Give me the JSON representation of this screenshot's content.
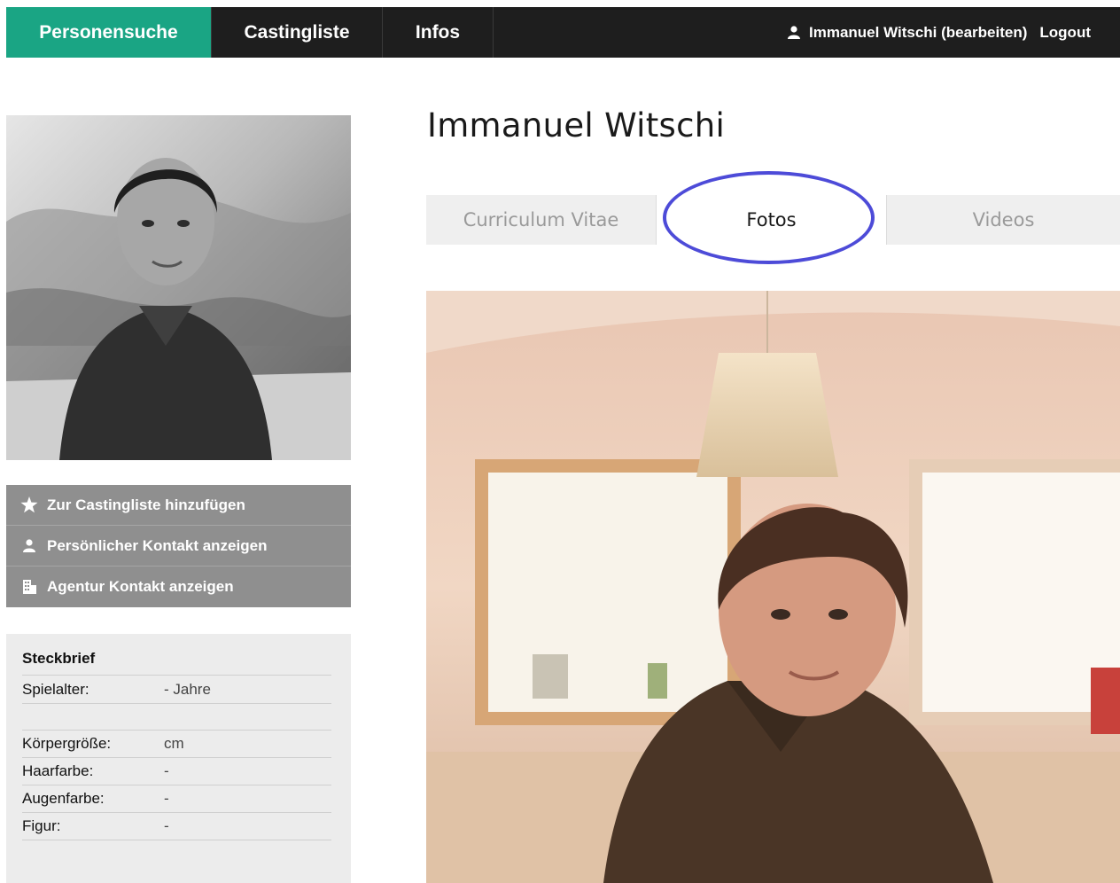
{
  "nav": {
    "items": [
      {
        "label": "Personensuche",
        "active": true
      },
      {
        "label": "Castingliste",
        "active": false
      },
      {
        "label": "Infos",
        "active": false
      }
    ],
    "user_label": "Immanuel Witschi (bearbeiten)",
    "logout_label": "Logout",
    "user_icon": "user-icon"
  },
  "profile": {
    "name": "Immanuel Witschi"
  },
  "actions": [
    {
      "icon": "star-icon",
      "label": "Zur Castingliste hinzufügen"
    },
    {
      "icon": "user-icon",
      "label": "Persönlicher Kontakt anzeigen"
    },
    {
      "icon": "building-icon",
      "label": "Agentur Kontakt anzeigen"
    }
  ],
  "steckbrief": {
    "title": "Steckbrief",
    "rows": [
      {
        "key": "Spielalter:",
        "value": "- Jahre"
      },
      {
        "key": "Körpergröße:",
        "value": "cm"
      },
      {
        "key": "Haarfarbe:",
        "value": "-"
      },
      {
        "key": "Augenfarbe:",
        "value": "-"
      },
      {
        "key": "Figur:",
        "value": "-"
      }
    ]
  },
  "tabs": [
    {
      "label": "Curriculum Vitae",
      "active": false
    },
    {
      "label": "Fotos",
      "active": true
    },
    {
      "label": "Videos",
      "active": false
    }
  ],
  "colors": {
    "accent": "#1aa584",
    "navbar": "#1e1e1e",
    "action_bg": "#8f8f8f",
    "highlight": "#4d4bd8"
  }
}
